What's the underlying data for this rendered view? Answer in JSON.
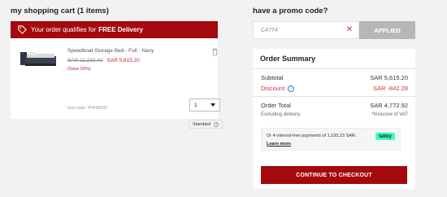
{
  "cart": {
    "title": "my shopping cart (1 items)",
    "delivery_banner": {
      "prefix": "Your order qualifies for",
      "highlight": "FREE Delivery",
      "icon": "tag-icon"
    },
    "item": {
      "name": "Speedboat Storage Bed - Full - Navy",
      "old_price": "SAR 11,230.40",
      "new_price": "SAR 5,615.20",
      "save_note": "(Save 50%)",
      "item_code": "Item code: PHF00003",
      "quantity": "1",
      "shipping_badge": "Standard"
    }
  },
  "promo": {
    "title": "have a promo code?",
    "code_value": "C4774",
    "clear_symbol": "✕",
    "applied_label": "APPLIED"
  },
  "summary": {
    "heading": "Order Summary",
    "subtotal_label": "Subtotal",
    "subtotal_value": "SAR 5,615.20",
    "discount_label": "Discount",
    "discount_value": "SAR -842.28",
    "total_label": "Order Total",
    "total_value": "SAR 4,772.92",
    "excluding_label": "Excluding delivery",
    "inclusive_label": "*Inclusive of VAT",
    "tabby_text": "Or 4 interest-free payments of 1,193.23 SAR.",
    "tabby_link": "Learn more",
    "tabby_logo": "tabby",
    "checkout_label": "CONTINUE TO CHECKOUT"
  },
  "colors": {
    "brand": "#a4090e",
    "discount": "#d0343b",
    "applied": "#b7b7b7",
    "tabby": "#3bffc1"
  }
}
